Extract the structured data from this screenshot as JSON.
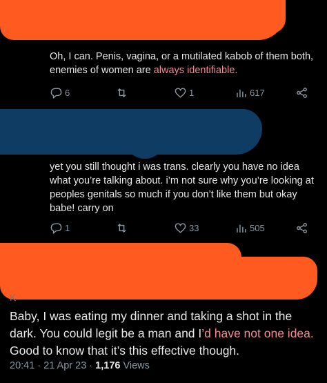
{
  "tweet1": {
    "text_plain": "Oh, I can. Penis, vagina, or a mutilated kabob of them both, enemies of women are ",
    "text_link": "always identifiable.",
    "replies": "6",
    "retweets": "",
    "likes": "1",
    "views": "617"
  },
  "tweet2": {
    "text": "yet you still thought i was trans. clearly you have no idea what you’re talking about. i’m not sure why you’re looking at peoples genitals so much if you don’t like them but okay babe! carry on",
    "replies": "1",
    "retweets": "",
    "likes": "33",
    "views": "505"
  },
  "main": {
    "handle_fragment": "K",
    "text_part1": "Baby, I was eating my dinner and taking a shot in the dark. You could legit be a man and I",
    "text_link": "’d have not one idea.",
    "text_part2": " Good to know that it’s this effective though.",
    "time": "20:41",
    "date": "21 Apr 23",
    "views_count": "1,176",
    "views_label": "Views"
  },
  "icons": [
    "reply-icon",
    "retweet-icon",
    "like-icon",
    "views-icon",
    "share-icon"
  ],
  "colors": {
    "background": "#000000",
    "text": "#e7e9ea",
    "muted": "#8b98a5",
    "redaction_orange": "#ff5a1f",
    "redaction_blue": "#0e3c63",
    "link_pink": "#f28b92"
  }
}
